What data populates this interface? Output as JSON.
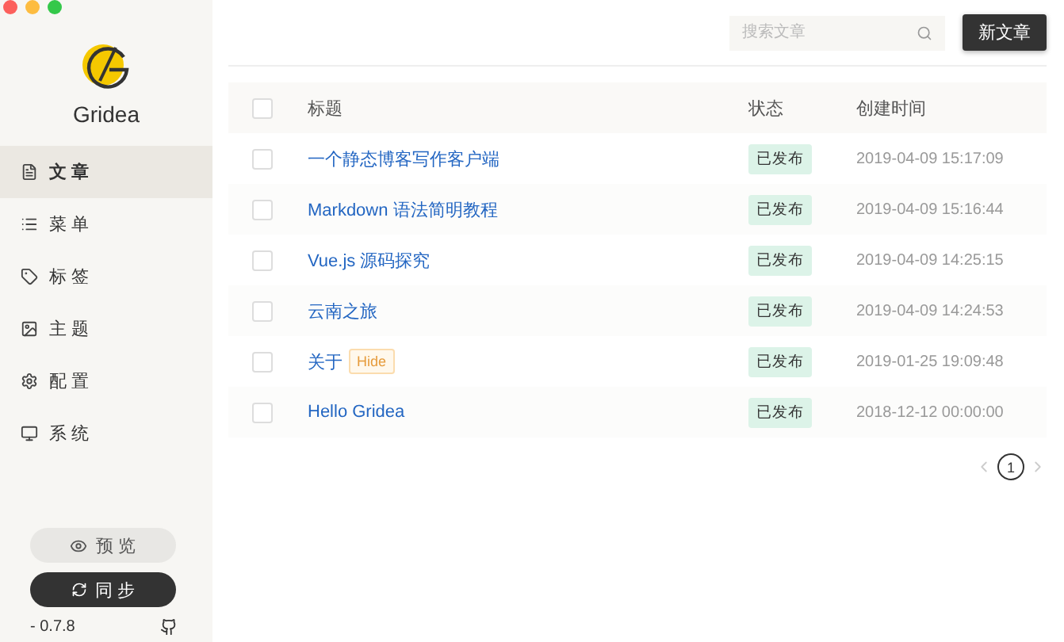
{
  "app": {
    "name": "Gridea",
    "version": "- 0.7.8"
  },
  "sidebar": {
    "items": [
      {
        "label": "文 章",
        "selected": true
      },
      {
        "label": "菜 单",
        "selected": false
      },
      {
        "label": "标 签",
        "selected": false
      },
      {
        "label": "主 题",
        "selected": false
      },
      {
        "label": "配 置",
        "selected": false
      },
      {
        "label": "系 统",
        "selected": false
      }
    ],
    "preview_button": "预 览",
    "sync_button": "同 步"
  },
  "toolbar": {
    "search": {
      "placeholder": "搜索文章"
    },
    "new_button": "新文章"
  },
  "table": {
    "select_all": {
      "checked": false
    },
    "columns": [
      "标题",
      "状态",
      "创建时间"
    ],
    "rows": [
      {
        "checked": false,
        "title": "一个静态博客写作客户端",
        "status": "已发布",
        "time": "2019-04-09 15:17:09"
      },
      {
        "checked": false,
        "title": "Markdown 语法简明教程",
        "status": "已发布",
        "time": "2019-04-09 15:16:44"
      },
      {
        "checked": false,
        "title": "Vue.js 源码探究",
        "status": "已发布",
        "time": "2019-04-09 14:25:15"
      },
      {
        "checked": false,
        "title": "云南之旅",
        "status": "已发布",
        "time": "2019-04-09 14:24:53"
      },
      {
        "checked": false,
        "title": "关于",
        "tag": "Hide",
        "status": "已发布",
        "time": "2019-01-25 19:09:48"
      },
      {
        "checked": false,
        "title": "Hello Gridea",
        "status": "已发布",
        "time": "2018-12-12 00:00:00"
      }
    ]
  },
  "pagination": {
    "pages": [
      {
        "label": "1",
        "selected": true
      }
    ]
  }
}
